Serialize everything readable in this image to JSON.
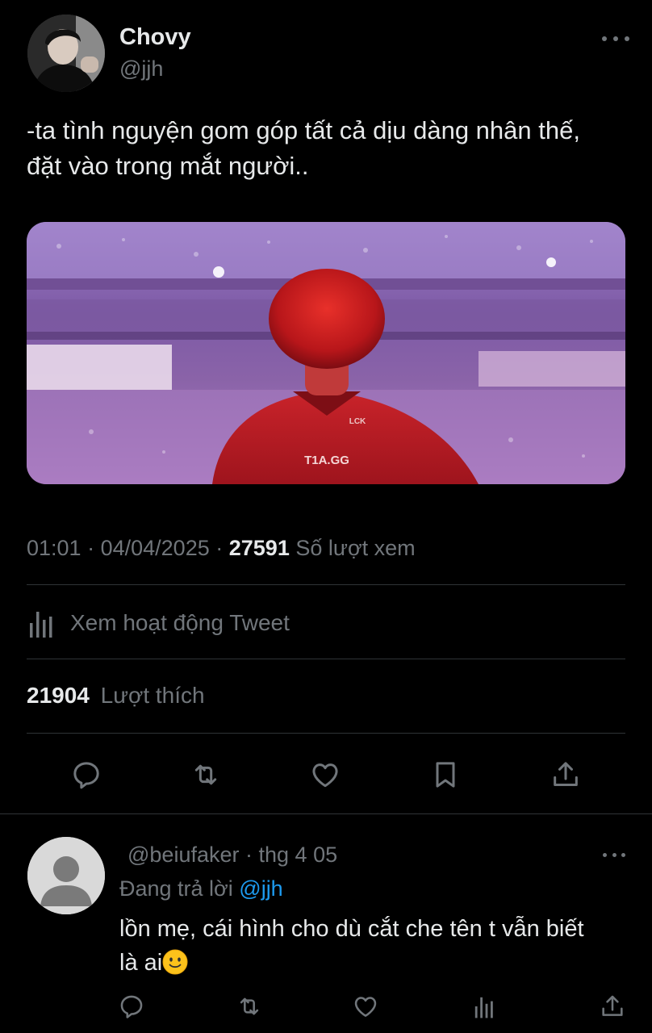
{
  "tweet": {
    "author": {
      "display_name": "Chovy",
      "handle": "@jjh"
    },
    "text_line1": "-ta tình nguyện gom góp tất cả dịu dàng nhân thế,",
    "text_line2": "đặt vào trong mắt người..",
    "media": {
      "jersey_text": "T1A.GG",
      "collar_text": "LCK"
    },
    "meta": {
      "time": "01:01",
      "date": "04/04/2025",
      "views_count": "27591",
      "views_label": "Số lượt xem"
    },
    "activity_label": "Xem hoạt động Tweet",
    "likes": {
      "count": "21904",
      "label": "Lượt thích"
    },
    "actions": [
      "reply-icon",
      "retweet-icon",
      "like-icon",
      "bookmark-icon",
      "share-icon"
    ]
  },
  "reply": {
    "handle": "@beiufaker",
    "separator": "·",
    "date": "thg 4 05",
    "replying_prefix": "Đang trả lời",
    "replying_mention": "@jjh",
    "text_line1": "lồn mẹ, cái hình cho dù cắt che tên t vẫn biết",
    "text_line2": "là ai",
    "emoji": "slightly-smiling-face",
    "actions": [
      "reply-icon",
      "retweet-icon",
      "like-icon",
      "analytics-icon",
      "share-icon"
    ]
  },
  "colors": {
    "background": "#000000",
    "text_primary": "#e7e9ea",
    "text_secondary": "#71767b",
    "divider": "#2f3336",
    "link": "#1d9bf0"
  }
}
